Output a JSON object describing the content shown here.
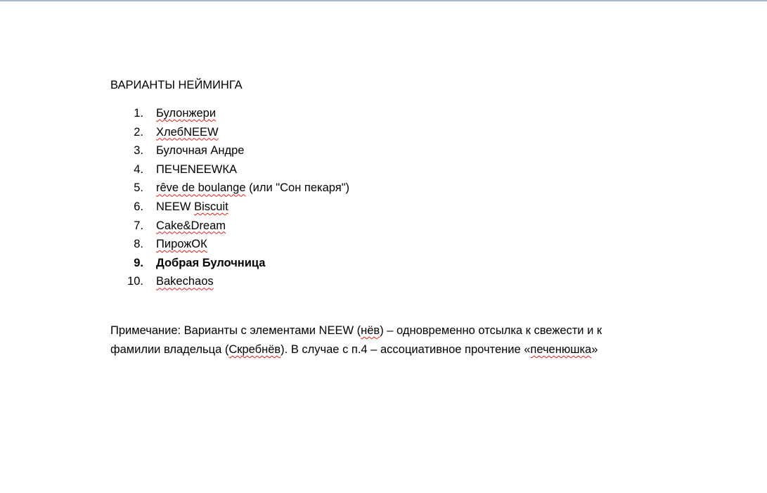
{
  "document": {
    "title": "ВАРИАНТЫ НЕЙМИНГА",
    "items": [
      {
        "number": "1.",
        "parts": [
          {
            "text": "Булонжери",
            "spell": true
          }
        ]
      },
      {
        "number": "2.",
        "parts": [
          {
            "text": "ХлебNEEW",
            "spell": true
          }
        ]
      },
      {
        "number": "3.",
        "parts": [
          {
            "text": "Булочная Андре",
            "spell": false
          }
        ]
      },
      {
        "number": "4.",
        "parts": [
          {
            "text": "ПЕЧЕNEEWКА",
            "spell": false
          }
        ]
      },
      {
        "number": "5.",
        "parts": [
          {
            "text": "rêve de boulange",
            "spell": true
          },
          {
            "text": " (или \"Сон пекаря\")",
            "spell": false
          }
        ]
      },
      {
        "number": "6.",
        "parts": [
          {
            "text": "NEEW ",
            "spell": false
          },
          {
            "text": "Biscuit",
            "spell": true
          }
        ]
      },
      {
        "number": "7.",
        "parts": [
          {
            "text": "Cake&Dream",
            "spell": true
          }
        ]
      },
      {
        "number": "8.",
        "parts": [
          {
            "text": "ПирожОК",
            "spell": true
          }
        ]
      },
      {
        "number": "9.",
        "bold": true,
        "parts": [
          {
            "text": "Добрая Булочница",
            "spell": false
          }
        ]
      },
      {
        "number": "10.",
        "parts": [
          {
            "text": "Bakechaos",
            "spell": true
          }
        ]
      }
    ],
    "note": {
      "line1": [
        {
          "text": "Примечание: Варианты с элементами NEEW (",
          "spell": false
        },
        {
          "text": "нёв",
          "spell": true
        },
        {
          "text": ") – одновременно отсылка к свежести и к",
          "spell": false
        }
      ],
      "line2": [
        {
          "text": "фамилии владельца (",
          "spell": false
        },
        {
          "text": "Скребнёв",
          "spell": true
        },
        {
          "text": "). В случае с п.4 – ассоциативное прочтение «",
          "spell": false
        },
        {
          "text": "печенюшка",
          "spell": true
        },
        {
          "text": "»",
          "spell": false
        }
      ]
    }
  }
}
